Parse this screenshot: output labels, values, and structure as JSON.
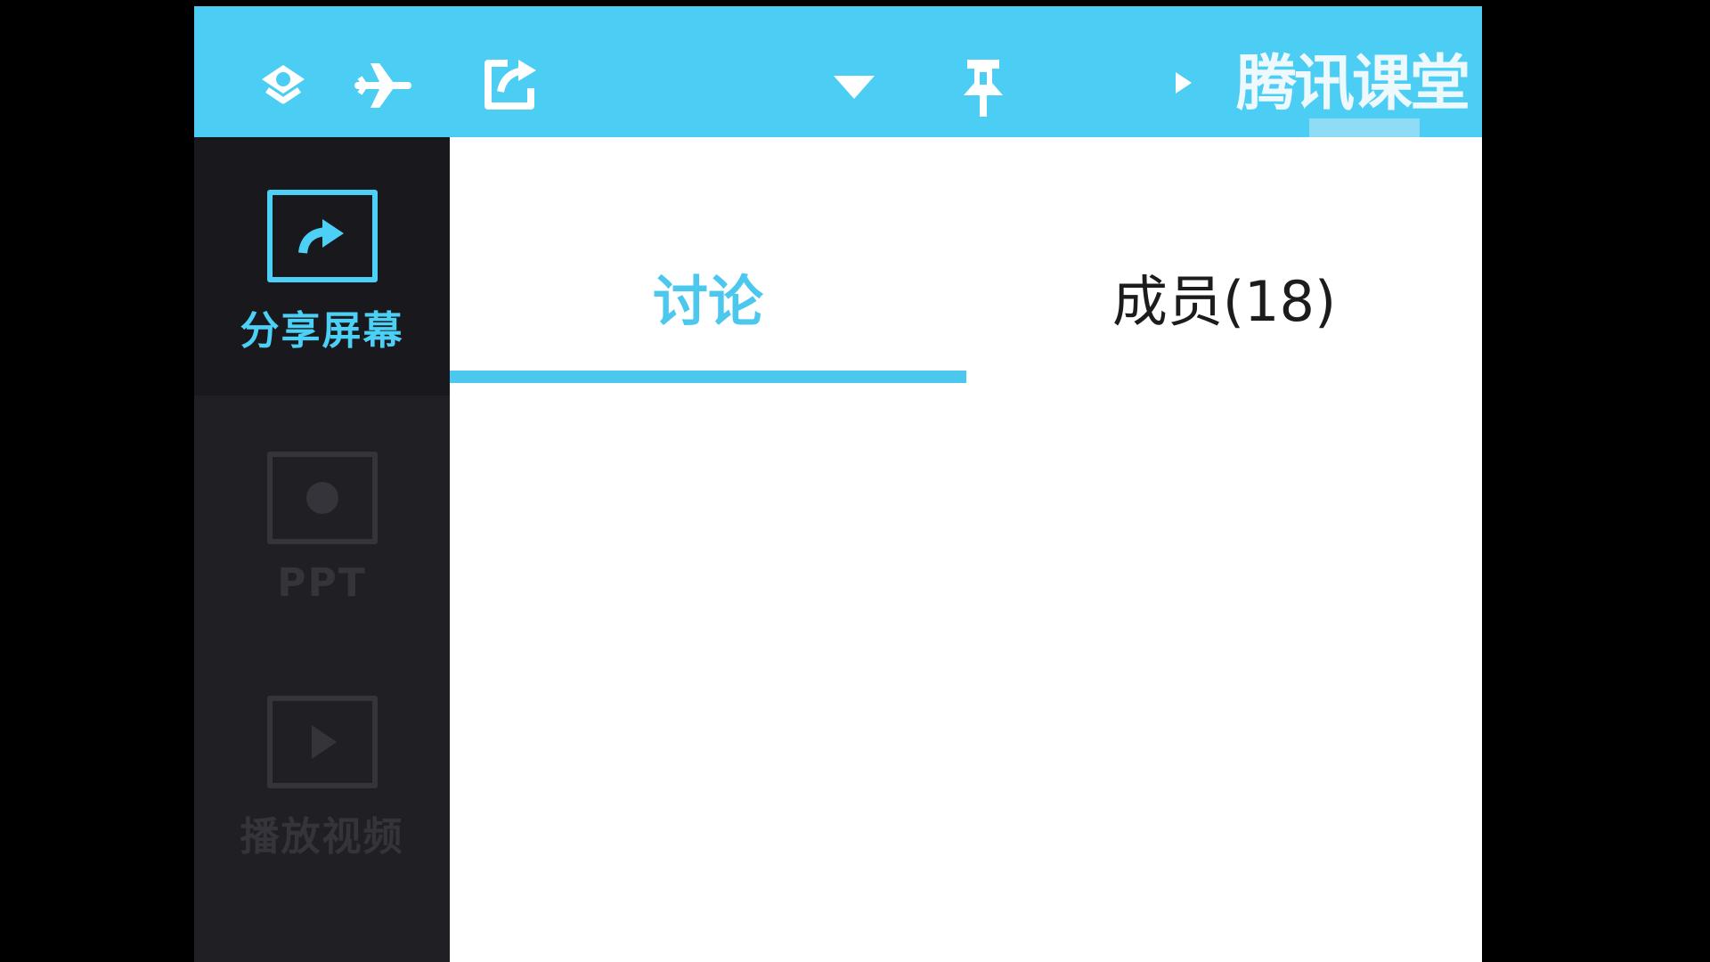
{
  "app": {
    "brand": "腾讯课堂",
    "accent_color": "#4ccdf4",
    "sidebar_bg": "#1f1f24"
  },
  "titlebar": {
    "icons": [
      "account-badge-icon",
      "airplane-icon",
      "share-out-icon",
      "dropdown-arrow-icon",
      "pin-icon",
      "play-arrow-icon"
    ]
  },
  "notice": {
    "icon": "megaphone-icon"
  },
  "sidebar": {
    "items": [
      {
        "label": "分享屏幕",
        "icon": "share-screen-icon",
        "state": "active"
      },
      {
        "label": "PPT",
        "icon": "ppt-icon",
        "state": "disabled"
      },
      {
        "label": "播放视频",
        "icon": "play-video-icon",
        "state": "disabled"
      }
    ]
  },
  "tabs": [
    {
      "label": "讨论",
      "selected": true
    },
    {
      "label": "成员(18)",
      "selected": false
    }
  ]
}
